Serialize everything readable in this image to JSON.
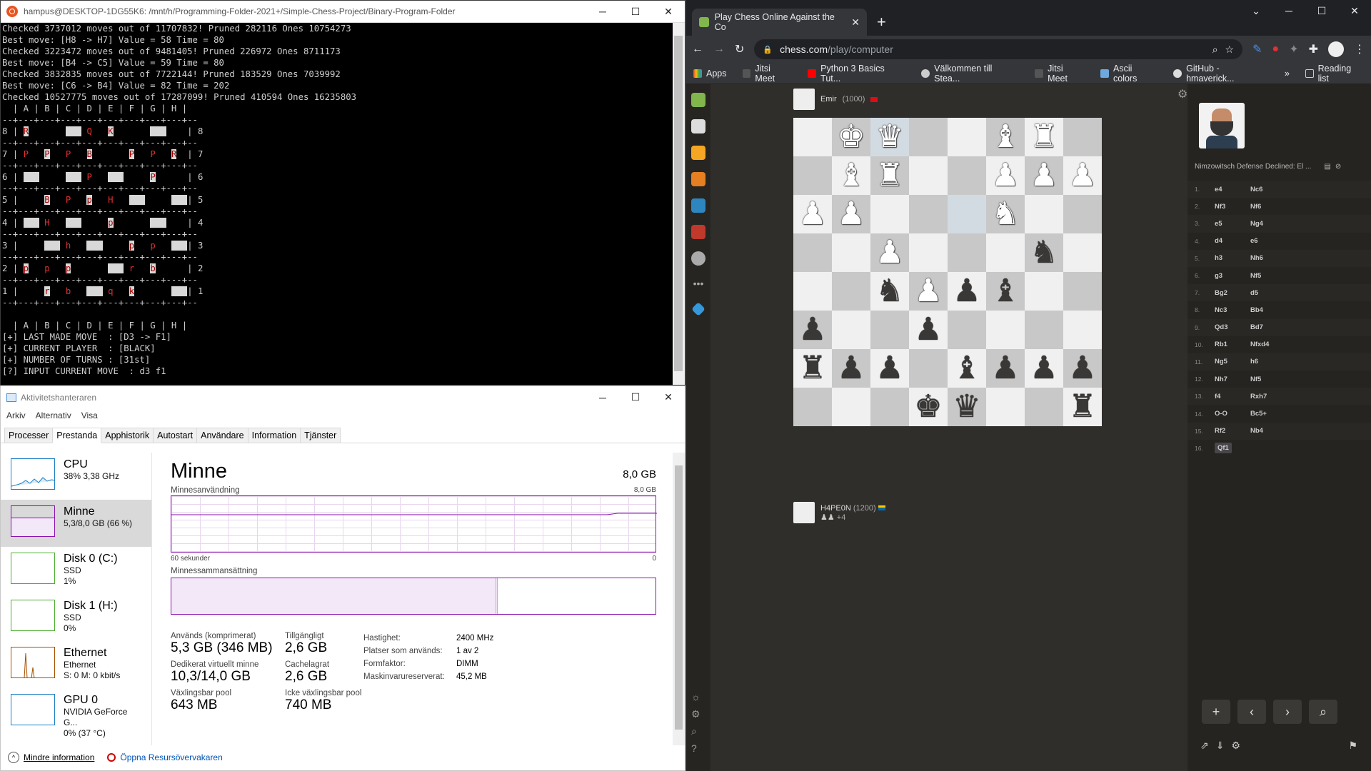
{
  "terminal": {
    "title": "hampus@DESKTOP-1DG55K6: /mnt/h/Programming-Folder-2021+/Simple-Chess-Project/Binary-Program-Folder",
    "lines": [
      "Checked 3737012 moves out of 11707832! Pruned 282116 Ones 10754273",
      "Best move: [H8 -> H7] Value = 58 Time = 80",
      "Checked 3223472 moves out of 9481405! Pruned 226972 Ones 8711173",
      "Best move: [B4 -> C5] Value = 59 Time = 80",
      "Checked 3832835 moves out of 7722144! Pruned 183529 Ones 7039992",
      "Best move: [C6 -> B4] Value = 82 Time = 202",
      "Checked 10527775 moves out of 17287099! Pruned 410594 Ones 16235803",
      "  | A | B | C | D | E | F | G | H |"
    ],
    "board_rows": [
      {
        "rank": "8",
        "cells": [
          "R",
          "",
          "",
          "Q",
          "K",
          "",
          "",
          ""
        ]
      },
      {
        "rank": "7",
        "cells": [
          "P",
          "P",
          "P",
          "B",
          "",
          "P",
          "P",
          "R"
        ]
      },
      {
        "rank": "6",
        "cells": [
          "",
          "",
          "",
          "P",
          "",
          "",
          "P",
          ""
        ]
      },
      {
        "rank": "5",
        "cells": [
          "",
          "B",
          "P",
          "p",
          "H",
          "",
          "",
          ""
        ]
      },
      {
        "rank": "4",
        "cells": [
          "",
          "H",
          "",
          "",
          "p",
          "",
          "",
          ""
        ]
      },
      {
        "rank": "3",
        "cells": [
          "",
          "",
          "h",
          "",
          "",
          "p",
          "p",
          ""
        ]
      },
      {
        "rank": "2",
        "cells": [
          "p",
          "p",
          "p",
          "",
          "",
          "r",
          "b",
          ""
        ]
      },
      {
        "rank": "1",
        "cells": [
          "",
          "r",
          "b",
          "",
          "q",
          "k",
          "",
          ""
        ]
      }
    ],
    "footer_header": "  | A | B | C | D | E | F | G | H |",
    "status": [
      "[+] LAST MADE MOVE  : [D3 -> F1]",
      "[+] CURRENT PLAYER  : [BLACK]",
      "[+] NUMBER OF TURNS : [31st]",
      "[?] INPUT CURRENT MOVE  : d3 f1"
    ]
  },
  "taskmanager": {
    "title": "Aktivitetshanteraren",
    "menu": [
      "Arkiv",
      "Alternativ",
      "Visa"
    ],
    "tabs": [
      "Processer",
      "Prestanda",
      "Apphistorik",
      "Autostart",
      "Användare",
      "Information",
      "Tjänster"
    ],
    "resources": [
      {
        "name": "CPU",
        "l2": "38% 3,38 GHz",
        "l3": "",
        "color": "#1c7fc3"
      },
      {
        "name": "Minne",
        "l2": "5,3/8,0 GB (66 %)",
        "l3": "",
        "color": "#8b12ae"
      },
      {
        "name": "Disk 0 (C:)",
        "l2": "SSD",
        "l3": "1%",
        "color": "#4caf30"
      },
      {
        "name": "Disk 1 (H:)",
        "l2": "SSD",
        "l3": "0%",
        "color": "#4caf30"
      },
      {
        "name": "Ethernet",
        "l2": "Ethernet",
        "l3": "S: 0 M: 0 kbit/s",
        "color": "#a74f01"
      },
      {
        "name": "GPU 0",
        "l2": "NVIDIA GeForce G...",
        "l3": "0% (37 °C)",
        "color": "#1c7fc3"
      }
    ],
    "main": {
      "title": "Minne",
      "total": "8,0 GB",
      "usage_label": "Minnesanvändning",
      "usage_max": "8,0 GB",
      "time_left": "60 sekunder",
      "time_right": "0",
      "composition_label": "Minnessammansättning",
      "stats": {
        "used_label": "Används (komprimerat)",
        "used": "5,3 GB (346 MB)",
        "avail_label": "Tillgängligt",
        "avail": "2,6 GB",
        "commit_label": "Dedikerat virtuellt minne",
        "commit": "10,3/14,0 GB",
        "cached_label": "Cachelagrat",
        "cached": "2,6 GB",
        "paged_label": "Växlingsbar pool",
        "paged": "643 MB",
        "nonpaged_label": "Icke växlingsbar pool",
        "nonpaged": "740 MB",
        "speed_label": "Hastighet:",
        "speed": "2400 MHz",
        "slots_label": "Platser som används:",
        "slots": "1 av 2",
        "form_label": "Formfaktor:",
        "form": "DIMM",
        "hw_label": "Maskinvarureserverat:",
        "hw": "45,2 MB"
      }
    },
    "footer": {
      "less": "Mindre information",
      "resmon": "Öppna Resursövervakaren"
    }
  },
  "browser": {
    "tab_title": "Play Chess Online Against the Co",
    "url_host": "chess.com",
    "url_path": "/play/computer",
    "bookmarks": [
      "Apps",
      "Jitsi Meet",
      "Python 3 Basics Tut...",
      "Välkommen till Stea...",
      "Jitsi Meet",
      "Ascii colors",
      "GitHub - hmaverick...",
      "»",
      "Reading list"
    ],
    "opponent": {
      "name": "Emir",
      "rating": "(1000)"
    },
    "player": {
      "name": "H4PE0N",
      "rating": "(1200)",
      "captured_extra": "+4"
    },
    "opening": "Nimzowitsch Defense Declined: El ...",
    "moves": [
      [
        "1.",
        "e4",
        "Nc6"
      ],
      [
        "2.",
        "Nf3",
        "Nf6"
      ],
      [
        "3.",
        "e5",
        "Ng4"
      ],
      [
        "4.",
        "d4",
        "e6"
      ],
      [
        "5.",
        "h3",
        "Nh6"
      ],
      [
        "6.",
        "g3",
        "Nf5"
      ],
      [
        "7.",
        "Bg2",
        "d5"
      ],
      [
        "8.",
        "Nc3",
        "Bb4"
      ],
      [
        "9.",
        "Qd3",
        "Bd7"
      ],
      [
        "10.",
        "Rb1",
        "Nfxd4"
      ],
      [
        "11.",
        "Ng5",
        "h6"
      ],
      [
        "12.",
        "Nh7",
        "Nf5"
      ],
      [
        "13.",
        "f4",
        "Rxh7"
      ],
      [
        "14.",
        "O-O",
        "Bc5+"
      ],
      [
        "15.",
        "Rf2",
        "Nb4"
      ],
      [
        "16.",
        "Qf1",
        ""
      ]
    ]
  }
}
